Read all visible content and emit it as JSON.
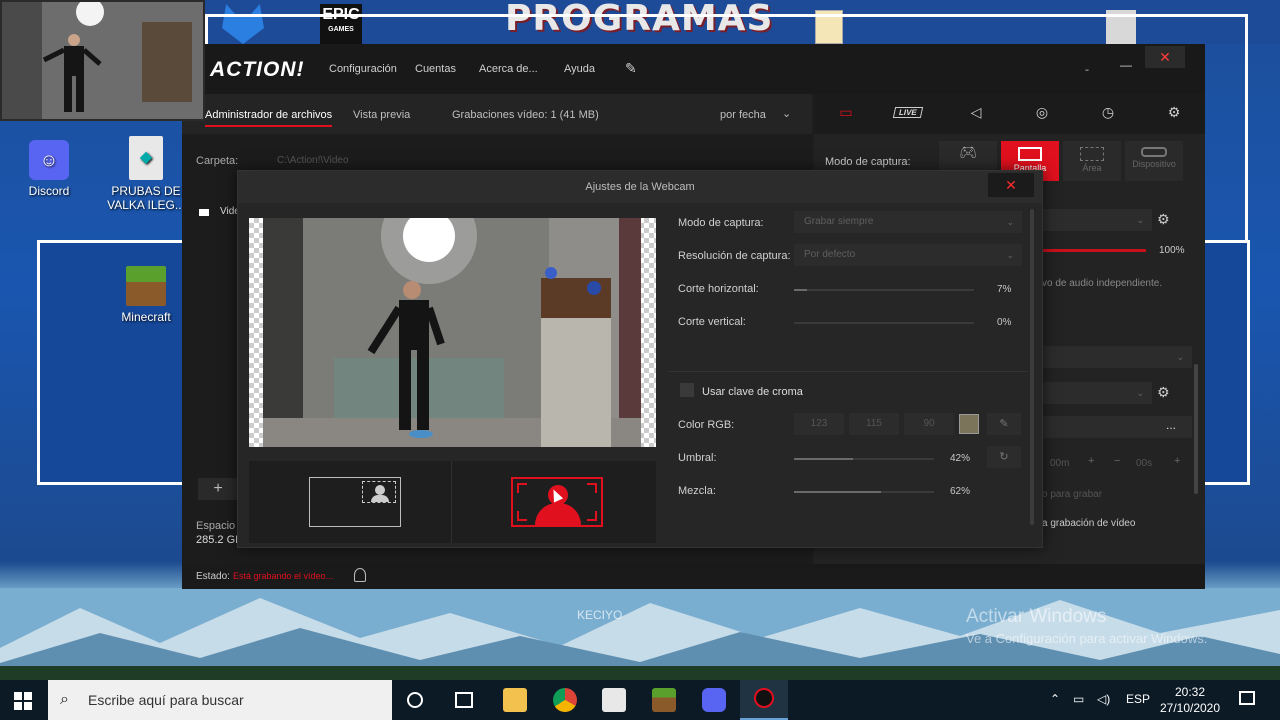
{
  "desktop": {
    "banner_text": "PROGRAMAS",
    "icons": [
      {
        "label": "Discord"
      },
      {
        "label": "PRUBAS DE VALKA ILEG..."
      },
      {
        "label": "Minecraft"
      }
    ],
    "epic_label": "EPIC",
    "epic_sub": "GAMES",
    "watermark_title": "Activar Windows",
    "watermark_sub": "Ve a Configuración para activar Windows.",
    "kecio_text": "KECIYO"
  },
  "app": {
    "logo": "ACTION!",
    "menu": {
      "configuracion": "Configuración",
      "cuentas": "Cuentas",
      "acerca": "Acerca de...",
      "ayuda": "Ayuda"
    },
    "tabs": {
      "archivos": "Administrador de archivos",
      "vista": "Vista previa",
      "grabaciones": "Grabaciones vídeo: 1 (41 MB)",
      "sort": "por fecha"
    },
    "carpeta_label": "Carpeta:",
    "carpeta_path": "C:\\Action!\\Video",
    "video_item": "Vide",
    "espacio_label": "Espacio l",
    "espacio_value": "285.2 GB",
    "estado_label": "Estado:",
    "estado_value": "Está grabando el vídeo...",
    "right": {
      "modo_captura": "Modo de captura:",
      "mode_pantalla": "Pantalla",
      "mode_area": "Área",
      "mode_dispositivo": "Dispositivo",
      "live": "LIVE",
      "volume_value": "100%",
      "audio_text": "vo de audio independiente.",
      "dots": "...",
      "timer_m": "00m",
      "timer_s": "00s",
      "para_grabar": "o para grabar",
      "grabacion_text": "a grabación de vídeo"
    }
  },
  "dialog": {
    "title": "Ajustes de la Webcam",
    "modo_captura_label": "Modo de captura:",
    "modo_captura_value": "Grabar siempre",
    "resolucion_label": "Resolución de captura:",
    "resolucion_value": "Por defecto",
    "corte_h_label": "Corte horizontal:",
    "corte_h_value": "7%",
    "corte_v_label": "Corte vertical:",
    "corte_v_value": "0%",
    "croma_label": "Usar clave de croma",
    "rgb_label": "Color RGB:",
    "rgb_r": "123",
    "rgb_g": "115",
    "rgb_b": "90",
    "umbral_label": "Umbral:",
    "umbral_value": "42%",
    "mezcla_label": "Mezcla:",
    "mezcla_value": "62%",
    "levels": {
      "corte_h": 0.07,
      "corte_v": 0.0,
      "umbral": 0.42,
      "mezcla": 0.62
    },
    "swatch_color": "#7b735a"
  },
  "taskbar": {
    "search_placeholder": "Escribe aquí para buscar",
    "lang": "ESP",
    "time": "20:32",
    "date": "27/10/2020"
  },
  "colors": {
    "accent": "#e1101e",
    "background": "#1e1e1e"
  }
}
